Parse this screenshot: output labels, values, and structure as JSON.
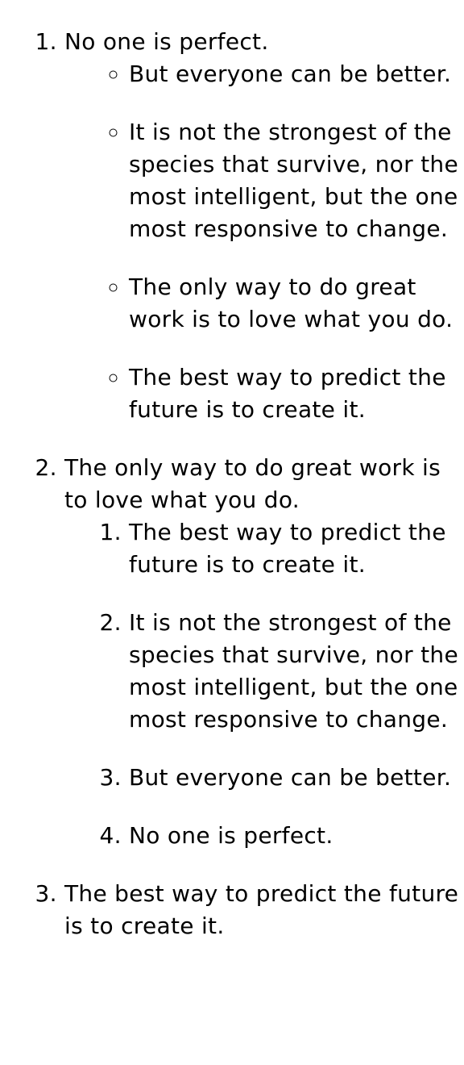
{
  "list": {
    "items": [
      {
        "text": "No one is perfect.",
        "subitems": [
          "But everyone can be better.",
          "It is not the strongest of the species that survive, nor the most intelligent, but the one most responsive to change.",
          "The only way to do great work is to love what you do.",
          "The best way to predict the future is to create it."
        ]
      },
      {
        "text": "The only way to do great work is to love what you do.",
        "subitems": [
          "The best way to predict the future is to create it.",
          "It is not the strongest of the species that survive, nor the most intelligent, but the one most responsive to change.",
          "But everyone can be better.",
          "No one is perfect."
        ]
      },
      {
        "text": "The best way to predict the future is to create it."
      }
    ]
  }
}
